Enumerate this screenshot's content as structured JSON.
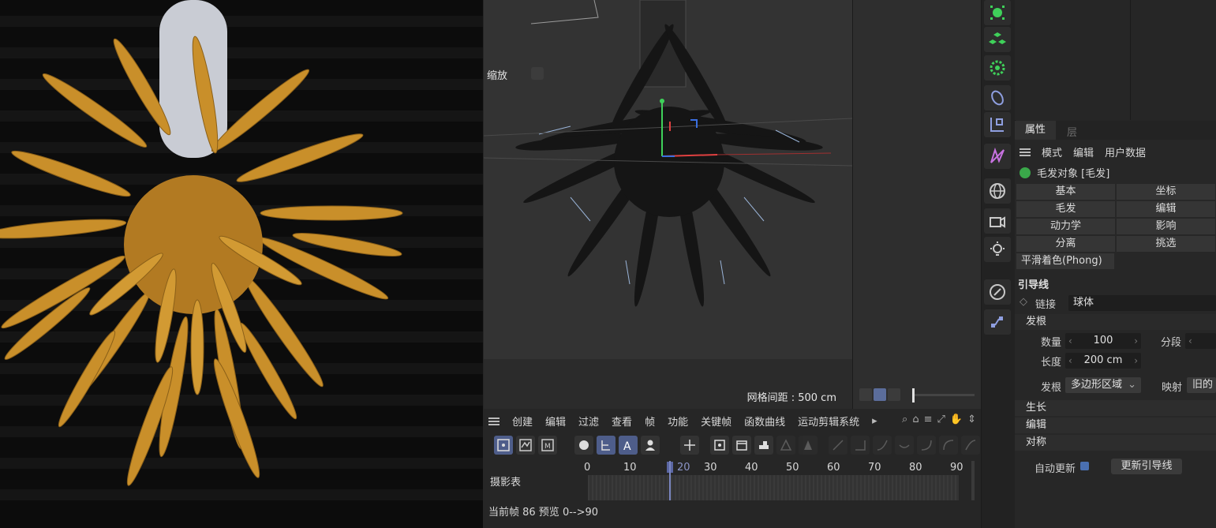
{
  "viewport": {
    "zoom_label": "缩放",
    "grid_spacing": "网格间距 : 500 cm"
  },
  "tools": {
    "icons": [
      "cloner-icon",
      "mograph-icon",
      "gear-sphere-icon",
      "deformer-icon",
      "spline-cube-icon",
      "field-icon",
      "globe-icon",
      "camera-icon",
      "light-icon",
      "pen-icon",
      "nodes-icon"
    ]
  },
  "properties": {
    "tab_active": "属性",
    "tab_inactive": "层",
    "menu": [
      "模式",
      "编辑",
      "用户数据"
    ],
    "object": "毛发对象 [毛发]",
    "tab_grid": [
      "基本",
      "坐标",
      "毛发",
      "编辑",
      "动力学",
      "影响",
      "分离",
      "挑选"
    ],
    "phong": "平滑着色(Phong)",
    "guides_title": "引导线",
    "link_label": "链接",
    "link_value": "球体",
    "roots_section": "发根",
    "count_label": "数量",
    "count_value": "100",
    "segments_label": "分段",
    "length_label": "长度",
    "length_value": "200 cm",
    "root_label": "发根",
    "root_value": "多边形区域",
    "mapping_label": "映射",
    "mapping_value": "旧的",
    "collapsed": [
      "生长",
      "编辑",
      "对称"
    ],
    "auto_update": "自动更新",
    "update_button": "更新引导线"
  },
  "timeline": {
    "menu": [
      "创建",
      "编辑",
      "过滤",
      "查看",
      "帧",
      "功能",
      "关键帧",
      "函数曲线",
      "运动剪辑系统"
    ],
    "dopesheet_label": "摄影表",
    "ruler": [
      "0",
      "10",
      "20",
      "30",
      "40",
      "50",
      "60",
      "70",
      "80",
      "90"
    ],
    "status": "当前帧  86  预览  0-->90",
    "current_frame": 20
  },
  "colors": {
    "accent": "#4e5d8a",
    "petal": "#c98f2a",
    "playhead": "#7a86c0"
  }
}
